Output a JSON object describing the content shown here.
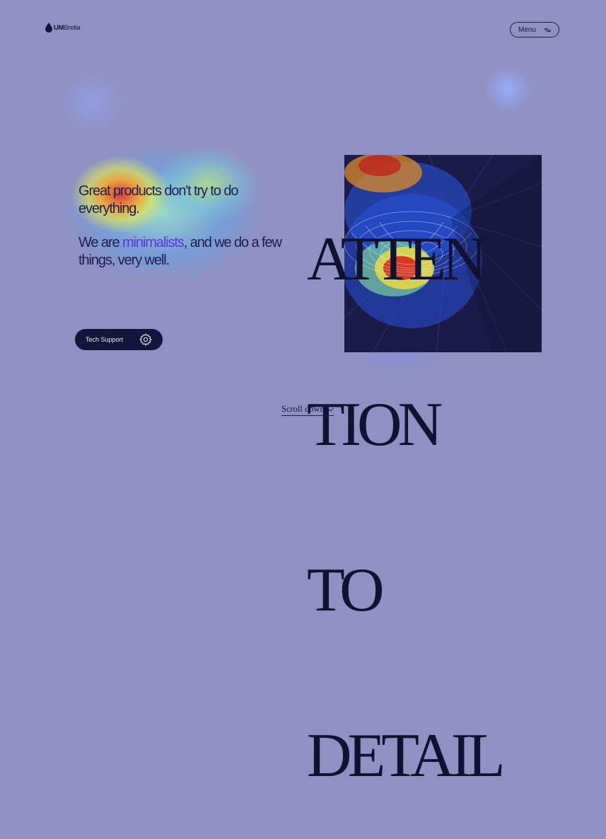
{
  "header": {
    "brand_bold": "UM",
    "brand_rest": "Brella",
    "menu_label": "Menu"
  },
  "hero": {
    "line1": "Great products don't try to do everything.",
    "line2_pre": "We are ",
    "line2_accent": "minimalists",
    "line2_post": ", and we do a few things, very well.",
    "headline": [
      "ATTEN",
      "TION",
      "TO",
      "DETAIL"
    ]
  },
  "support": {
    "label": "Tech Support"
  },
  "footer": {
    "scroll_label": "Scroll down"
  },
  "icons": [
    "drop-logo-icon",
    "menu-lines-icon",
    "gear-icon",
    "chevron-down-icon"
  ],
  "colors": {
    "background": "#9090c2",
    "text": "#1e1e4e",
    "accent": "#5b36d6",
    "button_dark": "#14153a"
  }
}
